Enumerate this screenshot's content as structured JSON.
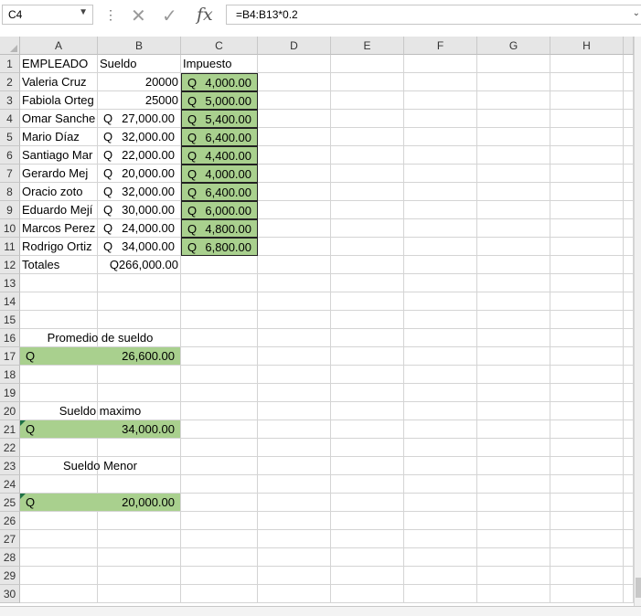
{
  "formula_bar": {
    "name_box": "C4",
    "formula": "=B4:B13*0.2"
  },
  "columns": [
    "A",
    "B",
    "C",
    "D",
    "E",
    "F",
    "G",
    "H"
  ],
  "rows": [
    "1",
    "2",
    "3",
    "4",
    "5",
    "6",
    "7",
    "8",
    "9",
    "10",
    "11",
    "12",
    "13",
    "14",
    "15",
    "16",
    "17",
    "18",
    "19",
    "20",
    "21",
    "22",
    "23",
    "24",
    "25",
    "26",
    "27",
    "28",
    "29",
    "30"
  ],
  "headers": {
    "a1": "EMPLEADO",
    "b1": "Sueldo",
    "c1": "Impuesto"
  },
  "employees": [
    {
      "name": "Valeria Cruz",
      "sueldo": "20000",
      "sueldo_currency": "",
      "impuesto": "4,000.00"
    },
    {
      "name": "Fabiola Orteg",
      "sueldo": "25000",
      "sueldo_currency": "",
      "impuesto": "5,000.00"
    },
    {
      "name": "Omar Sanche",
      "sueldo": "27,000.00",
      "sueldo_currency": "Q",
      "impuesto": "5,400.00"
    },
    {
      "name": "Mario Díaz",
      "sueldo": "32,000.00",
      "sueldo_currency": "Q",
      "impuesto": "6,400.00"
    },
    {
      "name": "Santiago Mar",
      "sueldo": "22,000.00",
      "sueldo_currency": "Q",
      "impuesto": "4,400.00"
    },
    {
      "name": " Gerardo Mej",
      "sueldo": "20,000.00",
      "sueldo_currency": "Q",
      "impuesto": "4,000.00"
    },
    {
      "name": "Oracio zoto",
      "sueldo": "32,000.00",
      "sueldo_currency": "Q",
      "impuesto": "6,400.00"
    },
    {
      "name": "Eduardo Mejí",
      "sueldo": "30,000.00",
      "sueldo_currency": "Q",
      "impuesto": "6,000.00"
    },
    {
      "name": "Marcos Perez",
      "sueldo": "24,000.00",
      "sueldo_currency": "Q",
      "impuesto": "4,800.00"
    },
    {
      "name": "Rodrigo Ortiz",
      "sueldo": "34,000.00",
      "sueldo_currency": "Q",
      "impuesto": "6,800.00"
    }
  ],
  "currency_symbol": "Q",
  "totals": {
    "label": "Totales",
    "value": "Q266,000.00"
  },
  "summary": {
    "promedio_label": "Promedio de sueldo",
    "promedio_value": "26,600.00",
    "maximo_label": "Sueldo maximo",
    "maximo_value": "34,000.00",
    "menor_label": "Sueldo Menor",
    "menor_value": "20,000.00"
  },
  "colors": {
    "green_fill": "#a9d08e",
    "header_bg": "#e6e6e6",
    "gridline": "#d4d4d4"
  },
  "icons": [
    "dropdown-arrow-icon",
    "more-dots-icon",
    "cancel-x-icon",
    "enter-check-icon",
    "insert-function-icon",
    "expand-formula-icon"
  ]
}
